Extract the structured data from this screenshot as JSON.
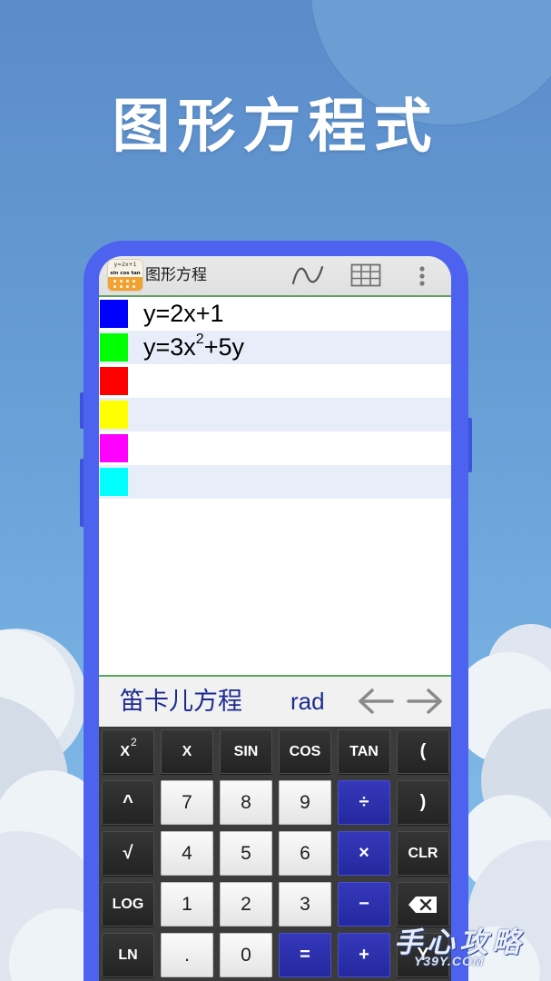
{
  "promo_title": "图形方程式",
  "app": {
    "title": "图形方程",
    "icon_text": {
      "line1": "y=2x+1",
      "line2": "sin cos tan"
    },
    "icons": {
      "logo": "app-logo-icon",
      "plot": "graph-wave-icon",
      "table": "table-grid-icon",
      "menu": "more-vert-icon"
    }
  },
  "equations": [
    {
      "color": "#0000ff",
      "text": "y=2x+1",
      "sup": "",
      "tail": ""
    },
    {
      "color": "#00ff00",
      "text": "y=3x",
      "sup": "2",
      "tail": "+5y"
    },
    {
      "color": "#ff0000",
      "text": "",
      "sup": "",
      "tail": ""
    },
    {
      "color": "#ffff00",
      "text": "",
      "sup": "",
      "tail": ""
    },
    {
      "color": "#ff00ff",
      "text": "",
      "sup": "",
      "tail": ""
    },
    {
      "color": "#00ffff",
      "text": "",
      "sup": "",
      "tail": ""
    }
  ],
  "mode_bar": {
    "equation_type": "笛卡儿方程",
    "angle_unit": "rad",
    "icons": {
      "prev": "left-arrow-icon",
      "next": "right-arrow-icon"
    }
  },
  "keypad": {
    "rows": [
      [
        {
          "label": "X",
          "sup": "2"
        },
        {
          "label": "X"
        },
        {
          "label": "SIN"
        },
        {
          "label": "COS"
        },
        {
          "label": "TAN"
        },
        {
          "label": "("
        }
      ],
      [
        {
          "label": "^"
        },
        {
          "label": "7"
        },
        {
          "label": "8"
        },
        {
          "label": "9"
        },
        {
          "label": "÷"
        },
        {
          "label": ")"
        }
      ],
      [
        {
          "label": "√"
        },
        {
          "label": "4"
        },
        {
          "label": "5"
        },
        {
          "label": "6"
        },
        {
          "label": "×"
        },
        {
          "label": "CLR"
        }
      ],
      [
        {
          "label": "LOG"
        },
        {
          "label": "1"
        },
        {
          "label": "2"
        },
        {
          "label": "3"
        },
        {
          "label": "−"
        },
        {
          "icon": "backspace-icon"
        }
      ],
      [
        {
          "label": "LN"
        },
        {
          "label": "."
        },
        {
          "label": "0"
        },
        {
          "label": "="
        },
        {
          "label": "+"
        },
        {
          "label": "Y"
        }
      ]
    ]
  },
  "colors": {
    "phone_frame": "#4d63ef",
    "key_dark": "#2c2c2c",
    "key_light": "#f0f0f0",
    "key_blue": "#2c30ae",
    "mode_text": "#1d2b8f",
    "divider_green": "#5ea35e"
  },
  "watermark": {
    "line1": "手心攻略",
    "line2": "Y39Y.COM"
  }
}
